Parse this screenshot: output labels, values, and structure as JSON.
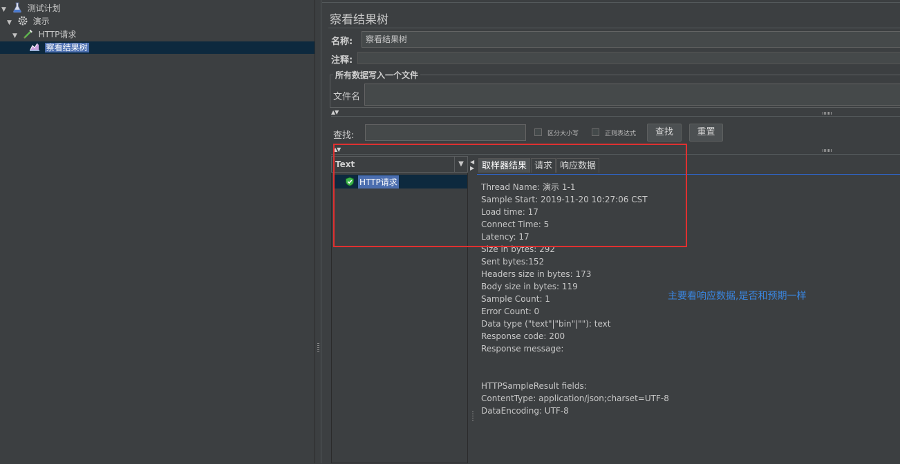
{
  "tree": {
    "items": [
      {
        "label": "测试计划",
        "icon": "test-plan-icon"
      },
      {
        "label": "演示",
        "icon": "thread-group-icon"
      },
      {
        "label": "HTTP请求",
        "icon": "http-sampler-icon"
      },
      {
        "label": "察看结果树",
        "icon": "results-tree-icon",
        "selected": true
      }
    ]
  },
  "panel": {
    "title": "察看结果树",
    "name_label": "名称:",
    "name_value": "察看结果树",
    "comment_label": "注释:",
    "file_group_legend": "所有数据写入一个文件",
    "filename_label": "文件名"
  },
  "search": {
    "label": "查找:",
    "value": "",
    "case_sensitive_label": "区分大小写",
    "regex_label": "正则表达式",
    "find_button": "查找",
    "reset_button": "重置"
  },
  "results": {
    "renderer_label": "Text",
    "sample_label": "HTTP请求",
    "sample_status_color": "#3cb44b",
    "tabs": [
      "取样器结果",
      "请求",
      "响应数据"
    ],
    "active_tab": 0,
    "lines": [
      "Thread Name: 演示 1-1",
      "Sample Start: 2019-11-20 10:27:06 CST",
      "Load time: 17",
      "Connect Time: 5",
      "Latency: 17",
      "Size in bytes: 292",
      "Sent bytes:152",
      "Headers size in bytes: 173",
      "Body size in bytes: 119",
      "Sample Count: 1",
      "Error Count: 0",
      "Data type (\"text\"|\"bin\"|\"\"): text",
      "Response code: 200",
      "Response message:",
      "",
      "",
      "HTTPSampleResult fields:",
      "ContentType: application/json;charset=UTF-8",
      "DataEncoding: UTF-8"
    ]
  },
  "annotation": {
    "note": "主要看响应数据,是否和预期一样",
    "highlight_color": "#e03030",
    "note_color": "#3a86e0"
  }
}
